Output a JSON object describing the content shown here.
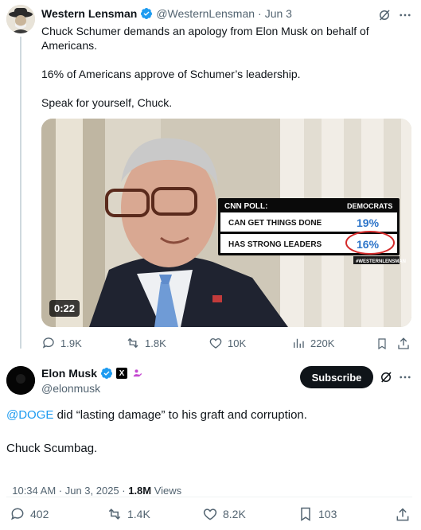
{
  "quoted": {
    "author_name": "Western Lensman",
    "handle": "@WesternLensman",
    "dot": "·",
    "date": "Jun 3",
    "text_lines": [
      "Chuck Schumer demands an apology from Elon Musk on behalf of",
      "Americans.",
      "16% of Americans approve of Schumer’s leadership.",
      "Speak for yourself, Chuck."
    ],
    "video": {
      "duration": "0:22",
      "overlay": {
        "poll_label": "CNN POLL:",
        "column_header": "DEMOCRATS",
        "rows": [
          {
            "label": "CAN GET THINGS DONE",
            "value": "19%"
          },
          {
            "label": "HAS STRONG LEADERS",
            "value": "16%"
          }
        ],
        "watermark": "#WESTERNLENSMAN"
      }
    },
    "actions": {
      "replies": "1.9K",
      "retweets": "1.8K",
      "likes": "10K",
      "views": "220K"
    }
  },
  "post": {
    "author_name": "Elon Musk",
    "handle": "@elonmusk",
    "subscribe_label": "Subscribe",
    "mention": "@DOGE",
    "text_rest": " did “lasting damage” to his graft and corruption.",
    "text_line2": "Chuck Scumbag.",
    "timestamp": "10:34 AM · Jun 3, 2025 · ",
    "views_count": "1.8M",
    "views_label": " Views",
    "actions": {
      "replies": "402",
      "retweets": "1.4K",
      "likes": "8.2K",
      "bookmarks": "103"
    }
  },
  "colors": {
    "accent": "#1d9bf0",
    "text": "#0f1419",
    "muted": "#536471",
    "divider": "#cfd9de"
  }
}
